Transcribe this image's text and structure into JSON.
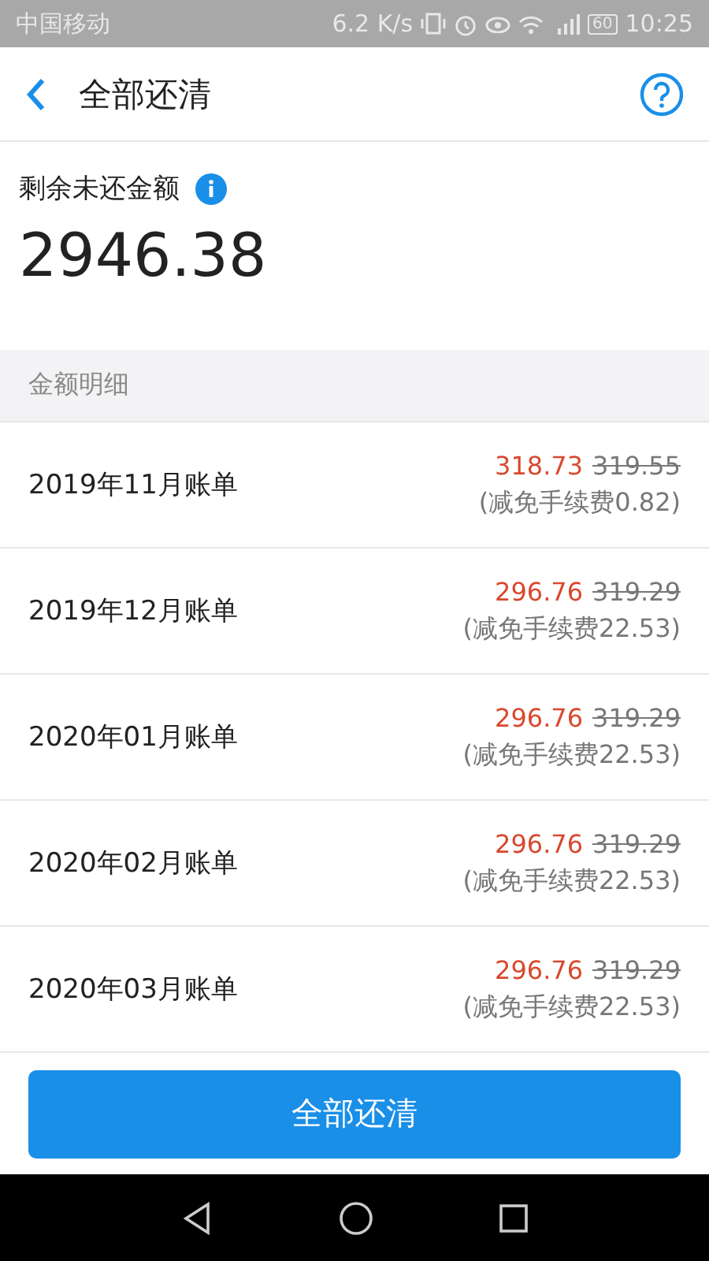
{
  "status_bar": {
    "carrier": "中国移动",
    "speed": "6.2 K/s",
    "battery": "60",
    "time": "10:25"
  },
  "header": {
    "title": "全部还清"
  },
  "summary": {
    "label": "剩余未还金额",
    "amount": "2946.38"
  },
  "section": {
    "title": "金额明细"
  },
  "bills": [
    {
      "name": "2019年11月账单",
      "amount": "318.73",
      "original": "319.55",
      "note": "(减免手续费0.82)"
    },
    {
      "name": "2019年12月账单",
      "amount": "296.76",
      "original": "319.29",
      "note": "(减免手续费22.53)"
    },
    {
      "name": "2020年01月账单",
      "amount": "296.76",
      "original": "319.29",
      "note": "(减免手续费22.53)"
    },
    {
      "name": "2020年02月账单",
      "amount": "296.76",
      "original": "319.29",
      "note": "(减免手续费22.53)"
    },
    {
      "name": "2020年03月账单",
      "amount": "296.76",
      "original": "319.29",
      "note": "(减免手续费22.53)"
    }
  ],
  "button": {
    "label": "全部还清"
  }
}
